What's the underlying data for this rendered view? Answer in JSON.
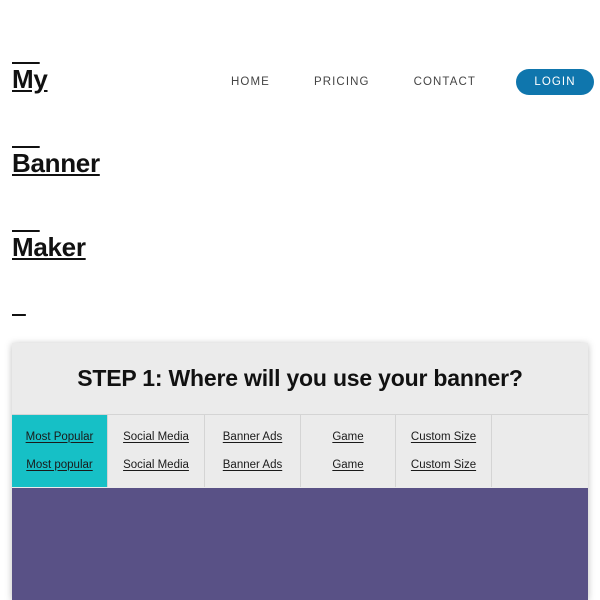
{
  "header": {
    "brand": {
      "line1": "My",
      "line2": "Banner",
      "line3": "Maker"
    },
    "nav": [
      {
        "label": "HOME"
      },
      {
        "label": "PRICING"
      },
      {
        "label": "CONTACT"
      }
    ],
    "login_label": "LOGIN",
    "login_color": "#0f76ad"
  },
  "step_panel": {
    "title": "STEP 1: Where will you use your banner?",
    "active_color": "#16c0c6",
    "panel_color": "#ebebeb",
    "tabs": [
      {
        "top_label": "Most Popular",
        "bottom_label": "Most popular",
        "active": true
      },
      {
        "top_label": "Social Media",
        "bottom_label": "Social Media",
        "active": false
      },
      {
        "top_label": "Banner Ads",
        "bottom_label": "Banner Ads",
        "active": false
      },
      {
        "top_label": "Game",
        "bottom_label": "Game",
        "active": false
      },
      {
        "top_label": "Custom Size",
        "bottom_label": "Custom Size",
        "active": false
      },
      {
        "top_label": "",
        "bottom_label": "",
        "active": false
      }
    ],
    "canvas_color": "#595186"
  }
}
